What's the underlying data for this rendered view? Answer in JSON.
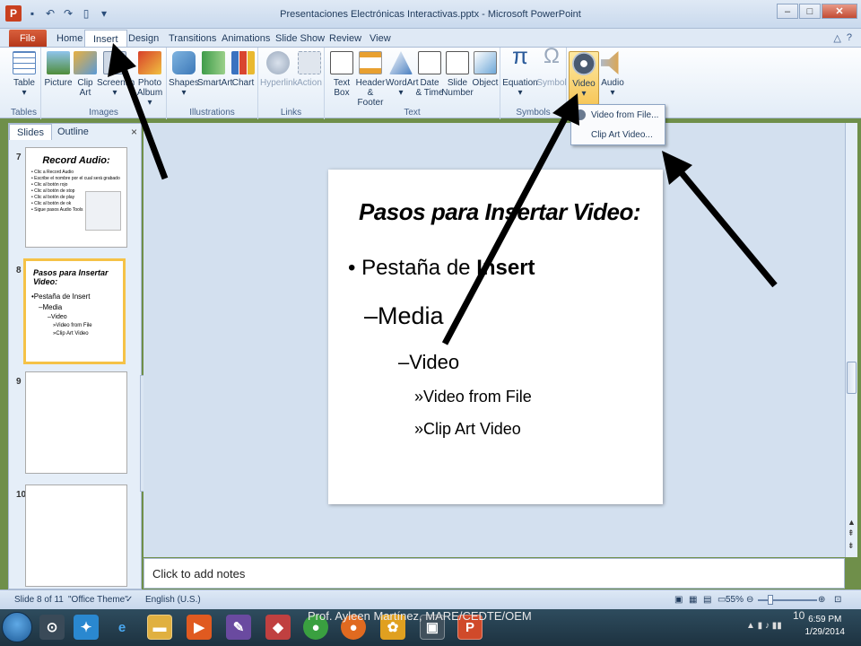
{
  "window": {
    "title": "Presentaciones Electrónicas Interactivas.pptx - Microsoft PowerPoint",
    "app_icon": "P",
    "controls": [
      "–",
      "□",
      "✕"
    ]
  },
  "tabs": [
    {
      "label": "File"
    },
    {
      "label": "Home"
    },
    {
      "label": "Insert"
    },
    {
      "label": "Design"
    },
    {
      "label": "Transitions"
    },
    {
      "label": "Animations"
    },
    {
      "label": "Slide Show"
    },
    {
      "label": "Review"
    },
    {
      "label": "View"
    }
  ],
  "ribbon": {
    "groups": [
      {
        "label": "Tables"
      },
      {
        "label": "Images"
      },
      {
        "label": "Illustrations"
      },
      {
        "label": "Links"
      },
      {
        "label": "Text"
      },
      {
        "label": "Symbols"
      }
    ],
    "buttons": {
      "table": "Table",
      "picture": "Picture",
      "clip_art_1": "Clip",
      "clip_art_2": "Art",
      "screenshot": "Screensh",
      "photo_album_1": "Photo",
      "photo_album_2": "Album",
      "shapes": "Shapes",
      "smartart": "SmartArt",
      "chart": "Chart",
      "hyperlink": "Hyperlink",
      "action": "Action",
      "text_box_1": "Text",
      "text_box_2": "Box",
      "header_footer_1": "Header",
      "header_footer_2": "& Footer",
      "wordart": "WordArt",
      "date_time_1": "Date",
      "date_time_2": "& Time",
      "slide_number_1": "Slide",
      "slide_number_2": "Number",
      "object": "Object",
      "equation": "Equation",
      "symbol": "Symbol",
      "video": "Video",
      "audio": "Audio"
    }
  },
  "video_menu": {
    "items": [
      "Video from File...",
      "Clip Art Video..."
    ]
  },
  "left_pane": {
    "tabs": [
      "Slides",
      "Outline"
    ],
    "close": "×",
    "thumbs": [
      {
        "number": "7",
        "title": "Record Audio:",
        "lines": [
          "• Clic a Record Audio",
          "• Escribe el nombre por el cual será grabado",
          "• Clic al botón rojo",
          "• Clic al botón de stop",
          "• Clic al botón de play",
          "• Clic al botón de ok",
          "• Sigue pasos Audio Tools"
        ]
      },
      {
        "number": "8",
        "title": "Pasos para Insertar Video:",
        "lines": [
          "•Pestaña de Insert",
          "–Media",
          "–Video",
          "»Video from File",
          "»Clip Art Video"
        ]
      },
      {
        "number": "9"
      },
      {
        "number": "10"
      }
    ]
  },
  "slide": {
    "title": "Pasos para Insertar Video:",
    "bullet1_prefix": "Pestaña de ",
    "bullet1_bold": "Insert",
    "level2": "–Media",
    "level3": "–Video",
    "level4a": "»Video from File",
    "level4b": "»Clip Art Video"
  },
  "notes": {
    "placeholder": "Click to add notes"
  },
  "status": {
    "slide_info": "Slide 8 of 11",
    "theme": "\"Office Theme\"",
    "language": "English (U.S.)",
    "zoom": "55%"
  },
  "footer": {
    "credit": "Prof. Ayleen Martínez, MARE/CEDTE/OEM",
    "page_number": "10"
  },
  "taskbar": {
    "time": "6:59 PM",
    "date": "1/29/2014"
  },
  "colors": {
    "file_tab": "#c3411f",
    "ribbon_bg": "#e2ecf7",
    "selected_thumb_border": "#f5c247",
    "arrow": "#000000"
  }
}
